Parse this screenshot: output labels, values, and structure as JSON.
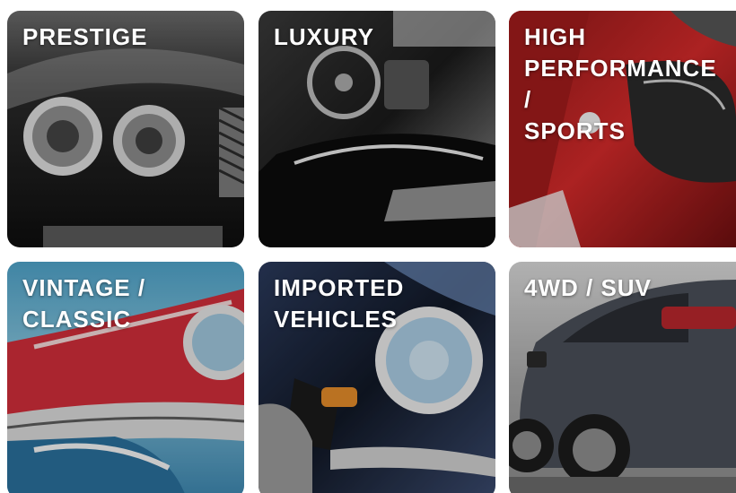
{
  "categories": [
    {
      "label": "PRESTIGE",
      "image": "black-luxury-car-headlights"
    },
    {
      "label": "LUXURY",
      "image": "black-convertible-interior"
    },
    {
      "label": "HIGH\nPERFORMANCE /\nSPORTS",
      "image": "red-sports-car-mirror"
    },
    {
      "label": "VINTAGE /\nCLASSIC",
      "image": "red-classic-car-chrome-grille"
    },
    {
      "label": "IMPORTED\nVEHICLES",
      "image": "vintage-car-round-headlight"
    },
    {
      "label": "4WD / SUV",
      "image": "grey-suv-rear"
    }
  ]
}
